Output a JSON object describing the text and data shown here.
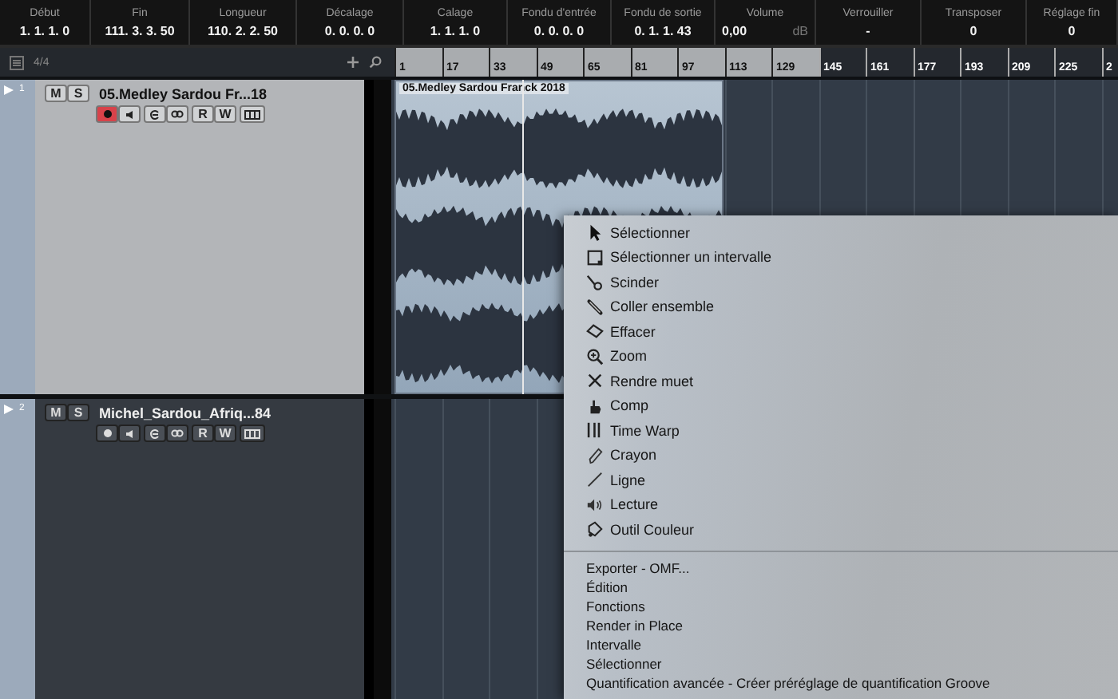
{
  "info_bar": [
    {
      "label": "Début",
      "value": "1. 1. 1. 0"
    },
    {
      "label": "Fin",
      "value": "111. 3. 3. 50"
    },
    {
      "label": "Longueur",
      "value": "110. 2. 2. 50"
    },
    {
      "label": "Décalage",
      "value": "0. 0. 0. 0"
    },
    {
      "label": "Calage",
      "value": "1. 1. 1. 0"
    },
    {
      "label": "Fondu d'entrée",
      "value": "0. 0. 0. 0"
    },
    {
      "label": "Fondu de sortie",
      "value": "0. 1. 1. 43"
    },
    {
      "label": "Volume",
      "value": "0,00",
      "unit": "dB"
    },
    {
      "label": "Verrouiller",
      "value": "-"
    },
    {
      "label": "Transposer",
      "value": "0"
    },
    {
      "label": "Réglage fin",
      "value": "0"
    }
  ],
  "track_list": {
    "count": "4/4"
  },
  "ruler": [
    {
      "label": "1",
      "in_range": true
    },
    {
      "label": "17",
      "in_range": true
    },
    {
      "label": "33",
      "in_range": true
    },
    {
      "label": "49",
      "in_range": true
    },
    {
      "label": "65",
      "in_range": true
    },
    {
      "label": "81",
      "in_range": true
    },
    {
      "label": "97",
      "in_range": true
    },
    {
      "label": "113",
      "in_range": true
    },
    {
      "label": "129",
      "in_range": true
    },
    {
      "label": "145",
      "in_range": false
    },
    {
      "label": "161",
      "in_range": false
    },
    {
      "label": "177",
      "in_range": false
    },
    {
      "label": "193",
      "in_range": false
    },
    {
      "label": "209",
      "in_range": false
    },
    {
      "label": "225",
      "in_range": false
    },
    {
      "label": "2",
      "in_range": false
    }
  ],
  "tracks": [
    {
      "number": "1",
      "name": "05.Medley Sardou Fr...18",
      "selected": true,
      "record_armed": true,
      "mute": "M",
      "solo": "S",
      "read": "R",
      "write": "W",
      "event": "05.Medley Sardou Franck 2018"
    },
    {
      "number": "2",
      "name": "Michel_Sardou_Afriq...84",
      "selected": false,
      "record_armed": false,
      "mute": "M",
      "solo": "S",
      "read": "R",
      "write": "W"
    }
  ],
  "context_menu": {
    "tools": [
      "Sélectionner",
      "Sélectionner un intervalle",
      "Scinder",
      "Coller ensemble",
      "Effacer",
      "Zoom",
      "Rendre muet",
      "Comp",
      "Time Warp",
      "Crayon",
      "Ligne",
      "Lecture",
      "Outil Couleur"
    ],
    "commands": [
      "Exporter - OMF...",
      "Édition",
      "Fonctions",
      "Render in Place",
      "Intervalle",
      "Sélectionner",
      "Quantification avancée - Créer préréglage de quantification Groove"
    ]
  }
}
